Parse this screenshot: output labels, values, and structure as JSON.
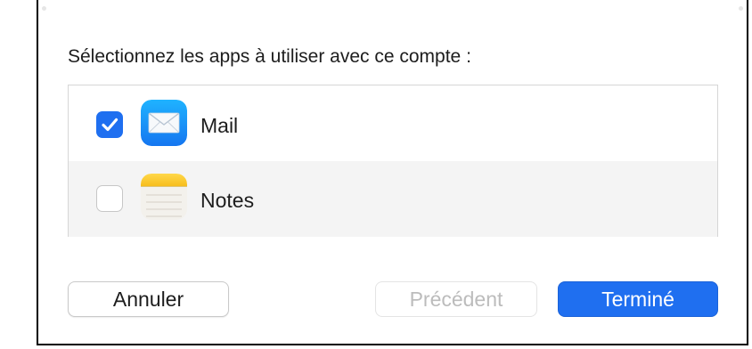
{
  "dialog": {
    "prompt": "Sélectionnez les apps à utiliser avec ce compte :",
    "apps": [
      {
        "label": "Mail",
        "checked": true,
        "icon": "mail-app-icon"
      },
      {
        "label": "Notes",
        "checked": false,
        "icon": "notes-app-icon"
      }
    ]
  },
  "buttons": {
    "cancel_label": "Annuler",
    "previous_label": "Précédent",
    "done_label": "Terminé"
  },
  "colors": {
    "accent": "#1f6ff0",
    "disabled_text": "#bcbcbc"
  }
}
